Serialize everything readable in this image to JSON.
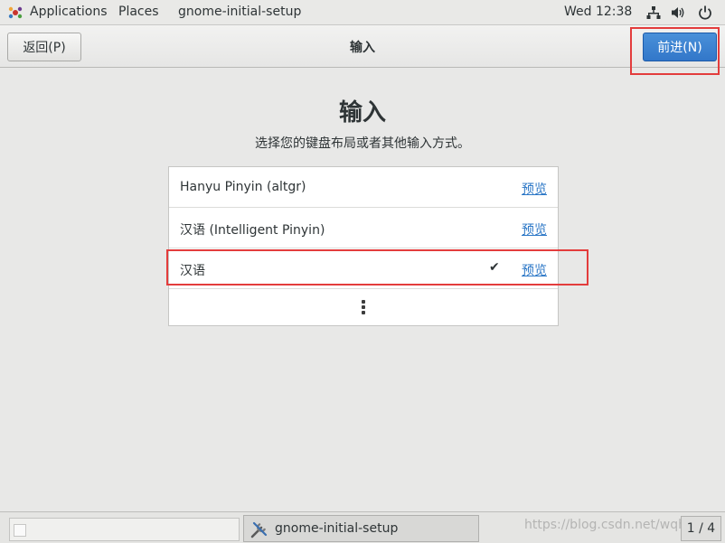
{
  "topbar": {
    "applications_label": "Applications",
    "places_label": "Places",
    "app_name": "gnome-initial-setup",
    "clock": "Wed 12:38"
  },
  "header": {
    "back_label": "返回(P)",
    "title": "输入",
    "next_label": "前进(N)"
  },
  "content": {
    "title": "输入",
    "description": "选择您的键盘布局或者其他输入方式。",
    "input_sources": [
      {
        "name": "Hanyu Pinyin (altgr)",
        "preview": "预览",
        "selected": false
      },
      {
        "name": "汉语 (Intelligent Pinyin)",
        "preview": "预览",
        "selected": false
      },
      {
        "name": "汉语",
        "preview": "预览",
        "selected": true
      }
    ]
  },
  "taskbar": {
    "window_label": "gnome-initial-setup",
    "watermark": "https://blog.csdn.net/wqh",
    "workspace": "1 / 4"
  },
  "colors": {
    "accent": "#3a83d1",
    "link": "#2a76c6",
    "highlight_box": "#e33c3c"
  }
}
